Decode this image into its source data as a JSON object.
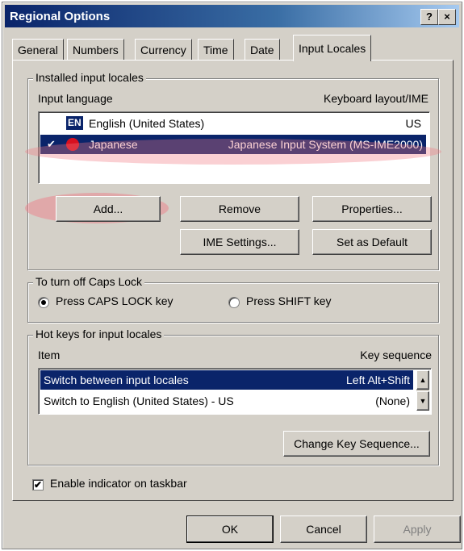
{
  "window": {
    "title": "Regional Options"
  },
  "titlebar_buttons": {
    "help": "?",
    "close": "×"
  },
  "tabs": [
    {
      "label": "General"
    },
    {
      "label": "Numbers"
    },
    {
      "label": "Currency"
    },
    {
      "label": "Time"
    },
    {
      "label": "Date"
    },
    {
      "label": "Input Locales",
      "active": true
    }
  ],
  "installed": {
    "legend": "Installed input locales",
    "col_language": "Input language",
    "col_layout": "Keyboard layout/IME",
    "rows": [
      {
        "badge": "EN",
        "language": "English (United States)",
        "layout": "US",
        "selected": false
      },
      {
        "badge": "✔",
        "language": "Japanese",
        "layout": "Japanese Input System (MS-IME2000)",
        "selected": true
      }
    ],
    "buttons": {
      "add": "Add...",
      "remove": "Remove",
      "properties": "Properties...",
      "ime_settings": "IME Settings...",
      "set_default": "Set as Default"
    }
  },
  "capslock": {
    "legend": "To turn off Caps Lock",
    "option1": "Press CAPS LOCK key",
    "option2": "Press SHIFT key",
    "selected": "option1"
  },
  "hotkeys": {
    "legend": "Hot keys for input locales",
    "col_item": "Item",
    "col_key": "Key sequence",
    "rows": [
      {
        "item": "Switch between input locales",
        "key": "Left Alt+Shift",
        "selected": true
      },
      {
        "item": "Switch to English (United States) - US",
        "key": "(None)",
        "selected": false
      }
    ],
    "change_button": "Change Key Sequence..."
  },
  "taskbar": {
    "label": "Enable indicator on taskbar",
    "checked": true
  },
  "footer": {
    "ok": "OK",
    "cancel": "Cancel",
    "apply": "Apply"
  },
  "colors": {
    "selection": "#0a246a",
    "highlight": "#f07882"
  }
}
